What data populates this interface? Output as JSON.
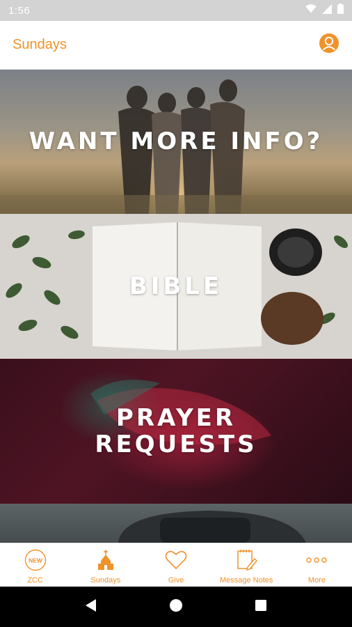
{
  "status_bar": {
    "time": "1:56",
    "icons": [
      "wifi-icon",
      "signal-icon",
      "battery-icon"
    ]
  },
  "app_bar": {
    "title": "Sundays",
    "profile_icon": "profile-icon"
  },
  "tiles": [
    {
      "label": "WANT MORE INFO?",
      "image": "group-of-friends-sunset-photo"
    },
    {
      "label": "BIBLE",
      "image": "open-bible-with-leaves-photo"
    },
    {
      "label": "PRAYER\nREQUESTS",
      "image": "praying-hands-red-light-photo"
    },
    {
      "label": "",
      "image": "headphones-photo"
    }
  ],
  "tab_bar": {
    "items": [
      {
        "label": "ZCC",
        "icon": "new-badge-icon",
        "badge": "NEW"
      },
      {
        "label": "Sundays",
        "icon": "church-icon"
      },
      {
        "label": "Give",
        "icon": "heart-icon"
      },
      {
        "label": "Message Notes",
        "icon": "notes-icon"
      },
      {
        "label": "More",
        "icon": "more-dots-icon"
      }
    ]
  },
  "nav_bar": {
    "buttons": [
      "back-icon",
      "home-icon",
      "recents-icon"
    ]
  },
  "colors": {
    "accent": "#f0922a",
    "status_bar": "#d3d3d3",
    "nav_bar": "#000000"
  }
}
